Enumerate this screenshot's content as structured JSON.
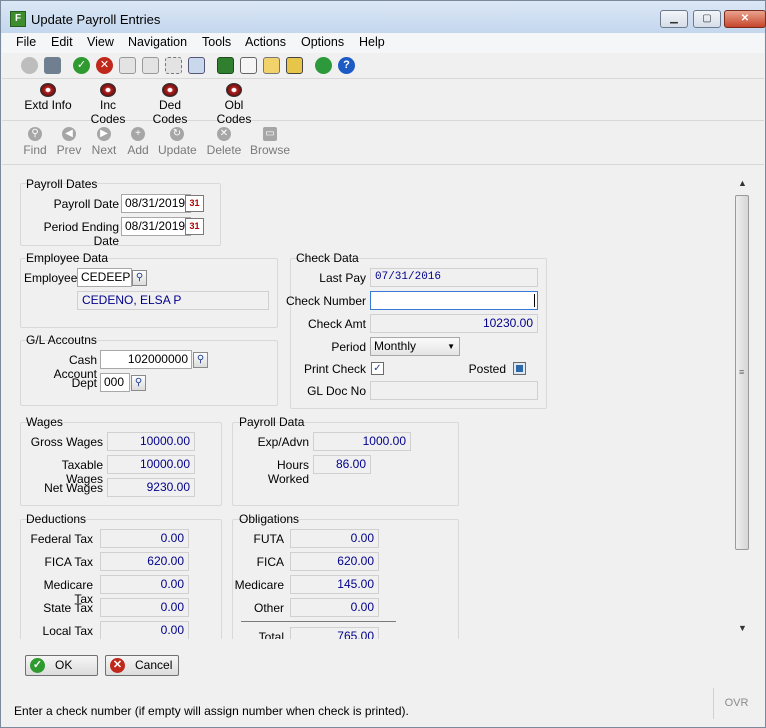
{
  "window": {
    "title": "Update Payroll Entries"
  },
  "menu": [
    "File",
    "Edit",
    "View",
    "Navigation",
    "Tools",
    "Actions",
    "Options",
    "Help"
  ],
  "toolbar2": [
    "Extd Info",
    "Inc Codes",
    "Ded Codes",
    "Obl Codes"
  ],
  "nav": [
    "Find",
    "Prev",
    "Next",
    "Add",
    "Update",
    "Delete",
    "Browse"
  ],
  "payroll_dates": {
    "title": "Payroll Dates",
    "payroll_date_label": "Payroll Date",
    "payroll_date": "08/31/2019",
    "period_end_label": "Period Ending Date",
    "period_end": "08/31/2019"
  },
  "employee": {
    "title": "Employee Data",
    "label": "Employee",
    "id": "CEDEEP",
    "name": "CEDENO, ELSA P"
  },
  "gl": {
    "title": "G/L Accoutns",
    "cash_label": "Cash Account",
    "cash": "102000000",
    "dept_label": "Dept",
    "dept": "000"
  },
  "check": {
    "title": "Check Data",
    "last_pay_label": "Last Pay",
    "last_pay": "07/31/2016",
    "check_number_label": "Check Number",
    "check_number": "",
    "check_amt_label": "Check Amt",
    "check_amt": "10230.00",
    "period_label": "Period",
    "period": "Monthly",
    "print_check_label": "Print Check",
    "posted_label": "Posted",
    "gl_doc_label": "GL Doc No",
    "gl_doc": ""
  },
  "wages": {
    "title": "Wages",
    "gross_label": "Gross Wages",
    "gross": "10000.00",
    "taxable_label": "Taxable Wages",
    "taxable": "10000.00",
    "net_label": "Net Wages",
    "net": "9230.00"
  },
  "payroll_data": {
    "title": "Payroll Data",
    "exp_label": "Exp/Advn",
    "exp": "1000.00",
    "hours_label": "Hours Worked",
    "hours": "86.00"
  },
  "deductions": {
    "title": "Deductions",
    "items": [
      {
        "label": "Federal Tax",
        "value": "0.00"
      },
      {
        "label": "FICA Tax",
        "value": "620.00"
      },
      {
        "label": "Medicare Tax",
        "value": "0.00"
      },
      {
        "label": "State Tax",
        "value": "0.00"
      },
      {
        "label": "Local Tax",
        "value": "0.00"
      }
    ]
  },
  "obligations": {
    "title": "Obligations",
    "items": [
      {
        "label": "FUTA",
        "value": "0.00"
      },
      {
        "label": "FICA",
        "value": "620.00"
      },
      {
        "label": "Medicare",
        "value": "145.00"
      },
      {
        "label": "Other",
        "value": "0.00"
      }
    ],
    "total_label": "Total",
    "total": "765.00"
  },
  "buttons": {
    "ok": "OK",
    "cancel": "Cancel"
  },
  "status": "Enter a check number (if empty will assign number when check is printed).",
  "ovr": "OVR",
  "colors": {
    "value_text": "#00008b",
    "title_gradient_top": "#dbe7f5"
  }
}
